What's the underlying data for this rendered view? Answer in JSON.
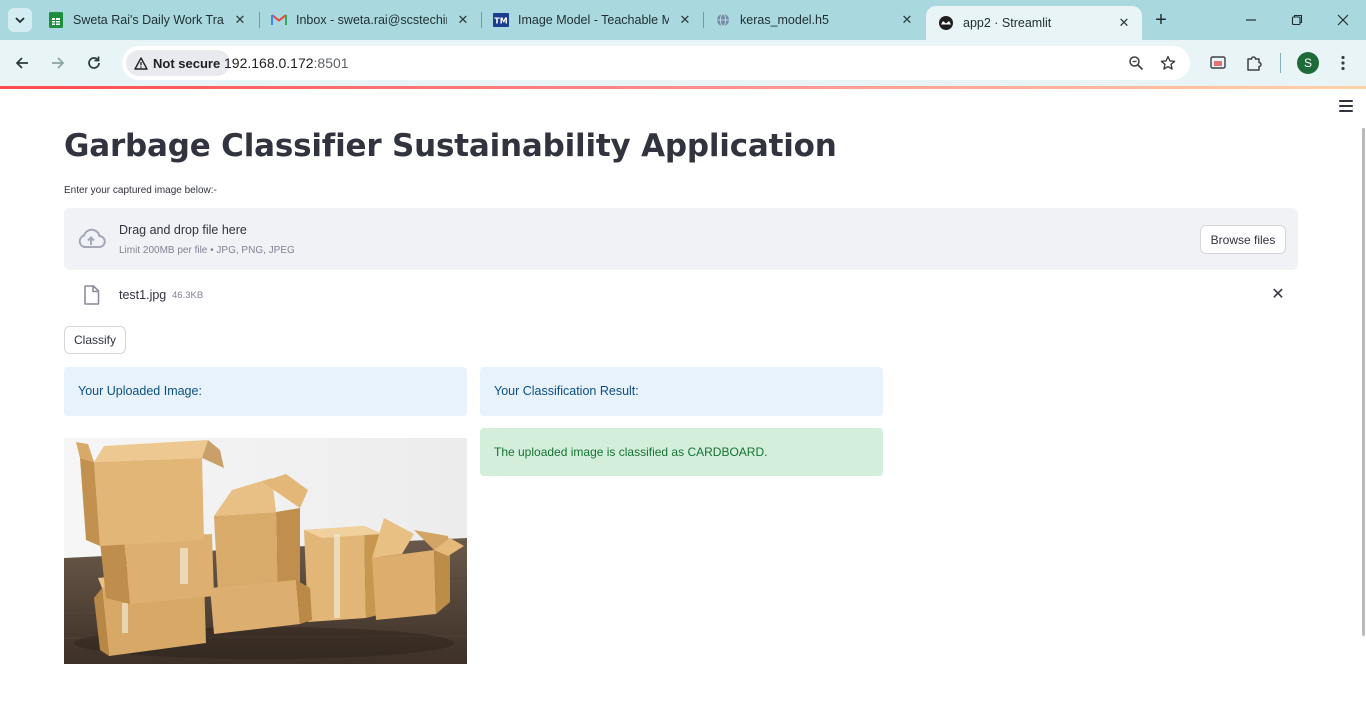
{
  "browser": {
    "tabs": [
      {
        "title": "Sweta Rai's Daily Work Track",
        "icon": "google-sheets-icon"
      },
      {
        "title": "Inbox - sweta.rai@scstechind",
        "icon": "gmail-icon"
      },
      {
        "title": "Image Model - Teachable Mach",
        "icon": "teachable-machine-icon"
      },
      {
        "title": "keras_model.h5",
        "icon": "globe-icon"
      },
      {
        "title": "app2 · Streamlit",
        "icon": "streamlit-icon"
      }
    ],
    "fav_text": {
      "tm": "TM"
    },
    "security_label": "Not secure",
    "url_host": "192.168.0.172",
    "url_port": ":8501",
    "profile_initial": "S"
  },
  "app": {
    "title": "Garbage Classifier Sustainability Application",
    "uploader_label": "Enter your captured image below:-",
    "dropzone_title": "Drag and drop file here",
    "dropzone_limits": "Limit 200MB per file • JPG, PNG, JPEG",
    "browse_label": "Browse files",
    "file_name": "test1.jpg",
    "file_size": "46.3KB",
    "classify_label": "Classify",
    "uploaded_header": "Your Uploaded Image:",
    "result_header": "Your Classification Result:",
    "result_text": "The uploaded image is classified as CARDBOARD."
  },
  "colors": {
    "tabstrip": "#a9d9df",
    "toolbar": "#e8f4f6",
    "info_bg": "#e8f2fc",
    "info_text": "#0b4f82",
    "success_bg": "#d3efdc",
    "success_text": "#177233",
    "accent": "#ff4b4b"
  }
}
